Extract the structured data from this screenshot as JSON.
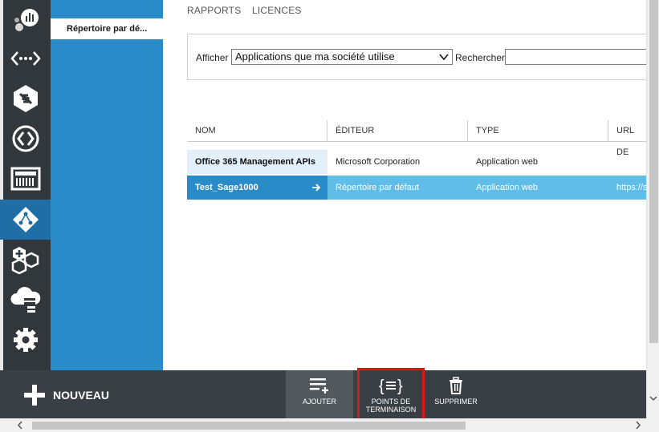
{
  "tabs": [
    "RAPPORTS",
    "LICENCES"
  ],
  "subnav": {
    "active_item": "Répertoire par dé..."
  },
  "rail": {
    "icons": [
      "analytics-icon",
      "api-connector-icon",
      "transfer-icon",
      "remote-connect-icon",
      "dashboard-icon",
      "active-directory-icon",
      "extensions-icon",
      "cloud-storage-icon",
      "settings-icon"
    ]
  },
  "filter": {
    "show_label": "Afficher",
    "show_value": "Applications que ma société utilise",
    "search_label": "Rechercher",
    "search_value": ""
  },
  "table": {
    "columns": [
      "NOM",
      "ÉDITEUR",
      "TYPE",
      "URL DE"
    ],
    "rows": [
      {
        "name": "Office 365 Management APIs",
        "publisher": "Microsoft Corporation",
        "type": "Application web",
        "url": ""
      },
      {
        "name": "Test_Sage1000",
        "publisher": "Répertoire par défaut",
        "type": "Application web",
        "url": "https://s"
      }
    ]
  },
  "commandbar": {
    "new_label": "NOUVEAU",
    "add_label": "AJOUTER",
    "endpoints_label_1": "POINTS DE",
    "endpoints_label_2": "TERMINAISON",
    "delete_label": "SUPPRIMER"
  },
  "colors": {
    "rail": "#32373c",
    "subnav": "#2a8bc9",
    "row_selected": "#5fbde8",
    "highlight_box": "#e01515"
  }
}
